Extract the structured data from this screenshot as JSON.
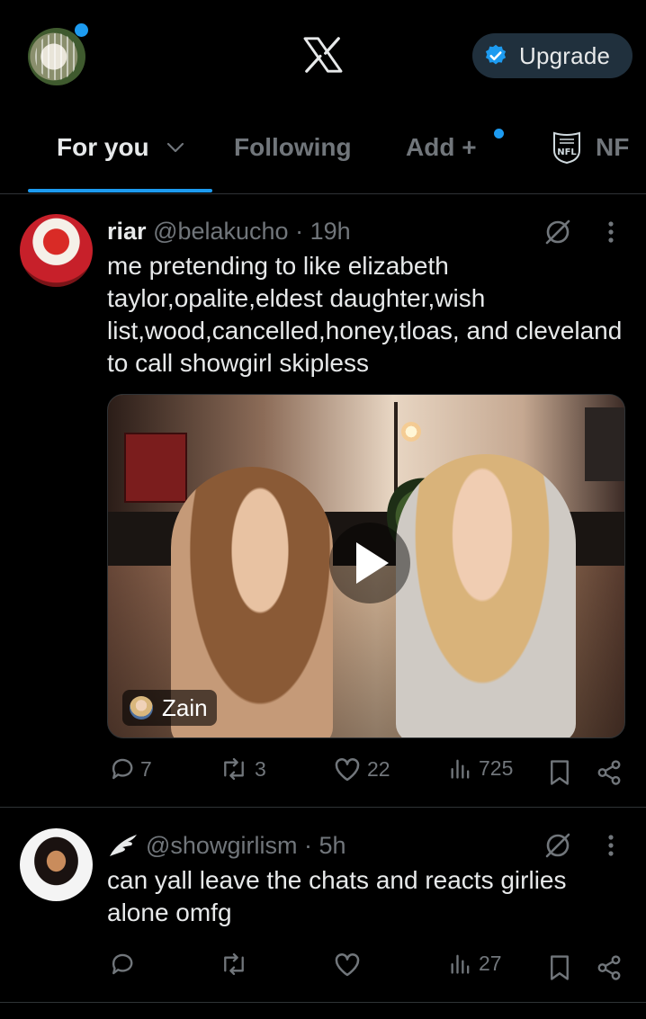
{
  "header": {
    "upgrade_label": "Upgrade"
  },
  "tabs": [
    {
      "label": "For you",
      "active": true
    },
    {
      "label": "Following"
    },
    {
      "label": "Add +"
    },
    {
      "label": "NF"
    }
  ],
  "posts": [
    {
      "display_name": "riar",
      "handle": "@belakucho",
      "separator": "·",
      "time": "19h",
      "text": "me pretending to like elizabeth taylor,opalite,eldest daughter,wish list,wood,cancelled,honey,tloas, and cleveland to call showgirl skipless",
      "media_tag": "Zain",
      "replies": "7",
      "reposts": "3",
      "likes": "22",
      "views": "725"
    },
    {
      "display_name": "",
      "handle": "@showgirlism",
      "separator": "·",
      "time": "5h",
      "text": "can yall leave the chats and reacts girlies alone omfg",
      "replies": "",
      "reposts": "",
      "likes": "",
      "views": "27"
    }
  ],
  "colors": {
    "accent": "#1d9bf0",
    "background": "#000000",
    "text": "#e7e9ea",
    "muted": "#71767b",
    "divider": "#2f3336"
  },
  "icons": [
    "x-logo-icon",
    "verified-badge-icon",
    "chevron-down-icon",
    "nfl-icon",
    "grok-icon",
    "more-icon",
    "reply-icon",
    "repost-icon",
    "like-icon",
    "views-icon",
    "bookmark-icon",
    "share-icon",
    "play-icon",
    "wing-icon"
  ]
}
